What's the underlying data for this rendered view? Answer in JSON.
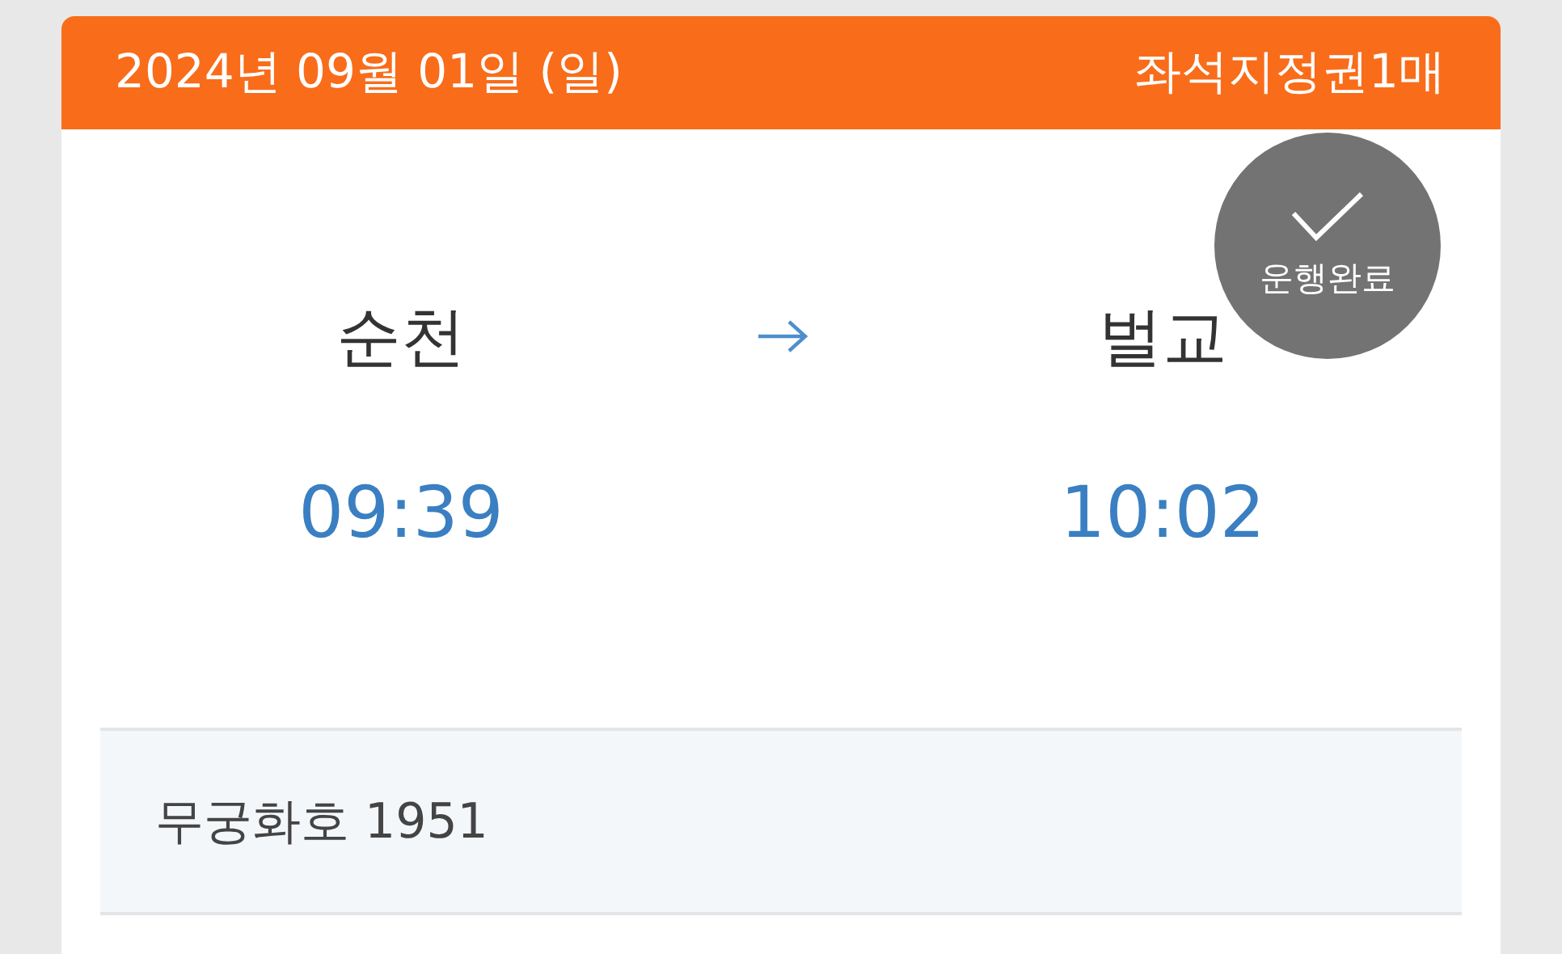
{
  "ticket": {
    "date": "2024년 09월 01일 (일)",
    "ticket_type": "좌석지정권1매",
    "status": {
      "kind": "completed",
      "label": "운행완료"
    },
    "departure": {
      "station": "순천",
      "time": "09:39"
    },
    "arrival": {
      "station": "벌교",
      "time": "10:02"
    },
    "train": "무궁화호 1951"
  }
}
